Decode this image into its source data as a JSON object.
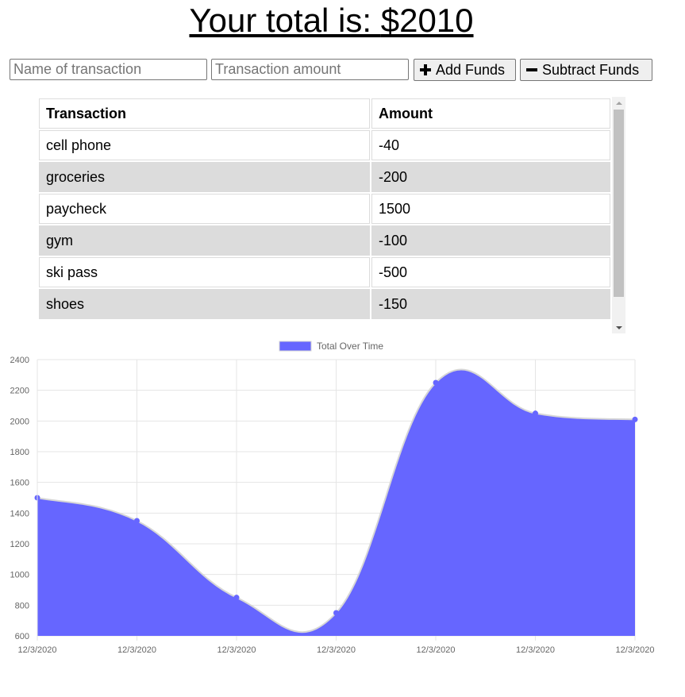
{
  "header": {
    "title_prefix": "Your total is: ",
    "total": "$2010"
  },
  "form": {
    "name_placeholder": "Name of transaction",
    "amount_placeholder": "Transaction amount",
    "add_label": "Add Funds",
    "subtract_label": "Subtract Funds"
  },
  "table": {
    "columns": [
      "Transaction",
      "Amount"
    ],
    "rows": [
      {
        "name": "cell phone",
        "amount": "-40"
      },
      {
        "name": "groceries",
        "amount": "-200"
      },
      {
        "name": "paycheck",
        "amount": "1500"
      },
      {
        "name": "gym",
        "amount": "-100"
      },
      {
        "name": "ski pass",
        "amount": "-500"
      },
      {
        "name": "shoes",
        "amount": "-150"
      }
    ]
  },
  "chart_data": {
    "type": "area",
    "x": [
      "12/3/2020",
      "12/3/2020",
      "12/3/2020",
      "12/3/2020",
      "12/3/2020",
      "12/3/2020",
      "12/3/2020"
    ],
    "series": [
      {
        "name": "Total Over Time",
        "values": [
          1500,
          1350,
          850,
          750,
          2250,
          2050,
          2010
        ],
        "color": "#6666ff"
      }
    ],
    "ylim": [
      600,
      2400
    ],
    "yticks": [
      600,
      800,
      1000,
      1200,
      1400,
      1600,
      1800,
      2000,
      2200,
      2400
    ],
    "grid": true,
    "legend": "top-center"
  }
}
